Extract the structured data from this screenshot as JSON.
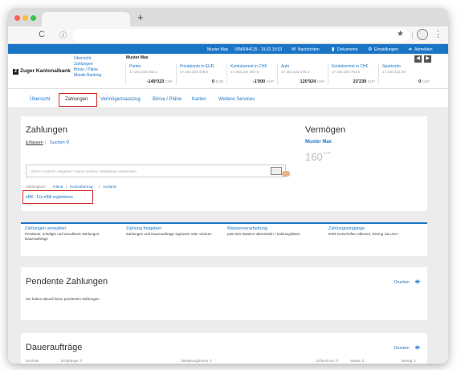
{
  "browser": {
    "newtab_label": "+",
    "back_icon": "back-arrow-icon",
    "reload_label": "C",
    "info_label": "ⓘ",
    "star_label": "★",
    "menu_label": "⋮"
  },
  "topbar": {
    "user": "Muster Max",
    "session": "00N0044115 - 19.02.15:53",
    "messages": "Nachrichten",
    "documents": "Dokumente",
    "settings": "Einstellungen",
    "logout": "Abmelden",
    "colors": {
      "bar": "#1a75c7"
    }
  },
  "bank": {
    "logo_mark": "Z",
    "name": "Zuger Kantonalbank",
    "links": [
      "Übersicht",
      "Zahlungen",
      "Börse / Pläne",
      "Mobile Banking"
    ],
    "owner": "Muster Max"
  },
  "accounts": [
    {
      "name": "Porten",
      "number": "17.202.324.566.1",
      "balance": "-149'023",
      "currency": "CHF"
    },
    {
      "name": "Privatkonto in EUR",
      "number": "17.202.324.448.0",
      "balance": "0",
      "currency": "EUR"
    },
    {
      "name": "Kontokorrent in CHF",
      "number": "17.202.324.467.6",
      "balance": "-1'000",
      "currency": "CHF"
    },
    {
      "name": "Auto",
      "number": "17.202.324.475.3",
      "balance": "120'924",
      "currency": "CHF"
    },
    {
      "name": "Kontokorrent in CHF",
      "number": "17.202.324.784.5",
      "balance": "23'239",
      "currency": "CHF"
    },
    {
      "name": "Sparkonto",
      "number": "17.150.341.00",
      "balance": "0",
      "currency": "CHF"
    }
  ],
  "acct_nav": {
    "prev": "◀",
    "next": "▶"
  },
  "mainnav": [
    "Übersicht",
    "Zahlungen",
    "Vermögensauszug",
    "Börse / Pläne",
    "Karten",
    "Weitere Services"
  ],
  "zahlungen": {
    "title": "Zahlungen",
    "tab_erfassen": "Erfassen",
    "tab_sep": "|",
    "tab_suchen": "Suchen",
    "search_icon": "search-icon",
    "search_placeholder": "IBAN / Kontonr. eingeben / Name suchen / Belegleser verwenden",
    "quick_links": [
      "Zahlungsart:",
      "Inland",
      "|",
      "Kontoübertrag",
      "|",
      "Ausland"
    ],
    "ebill_link": "eBill - Für eBill registrieren"
  },
  "vermoegen": {
    "title": "Vermögen",
    "owner": "Muster Max",
    "value": "160",
    "currency": "CHF"
  },
  "cards": [
    {
      "title": "Zahlungen verwalten",
      "desc": "Pendente, erledigte und annullierte Zahlungen, Daueraufträge"
    },
    {
      "title": "Zahlung freigeben",
      "desc": "Zahlungen und Daueraufträge signieren oder visieren"
    },
    {
      "title": "Massenverarbeitung",
      "desc": "pain.001-Dateien übermitteln / Zahlungslisten"
    },
    {
      "title": "Zahlungseingänge",
      "desc": "ESR-Gutschriften ablesen, Einzug via LSV+"
    }
  ],
  "pendente": {
    "title": "Pendente Zahlungen",
    "print_label": "Drucken",
    "empty_text": "Sie haben aktuell keine pendenten Zahlungen."
  },
  "dauerauftraege": {
    "title": "Daueraufträge",
    "print_label": "Drucken",
    "headers": [
      "Nächste",
      "Empfänger ⇕",
      "Belastungskonto ⇕",
      "Erfasst von ⇕",
      "Status ⇕",
      "Betrag ⇕"
    ]
  }
}
